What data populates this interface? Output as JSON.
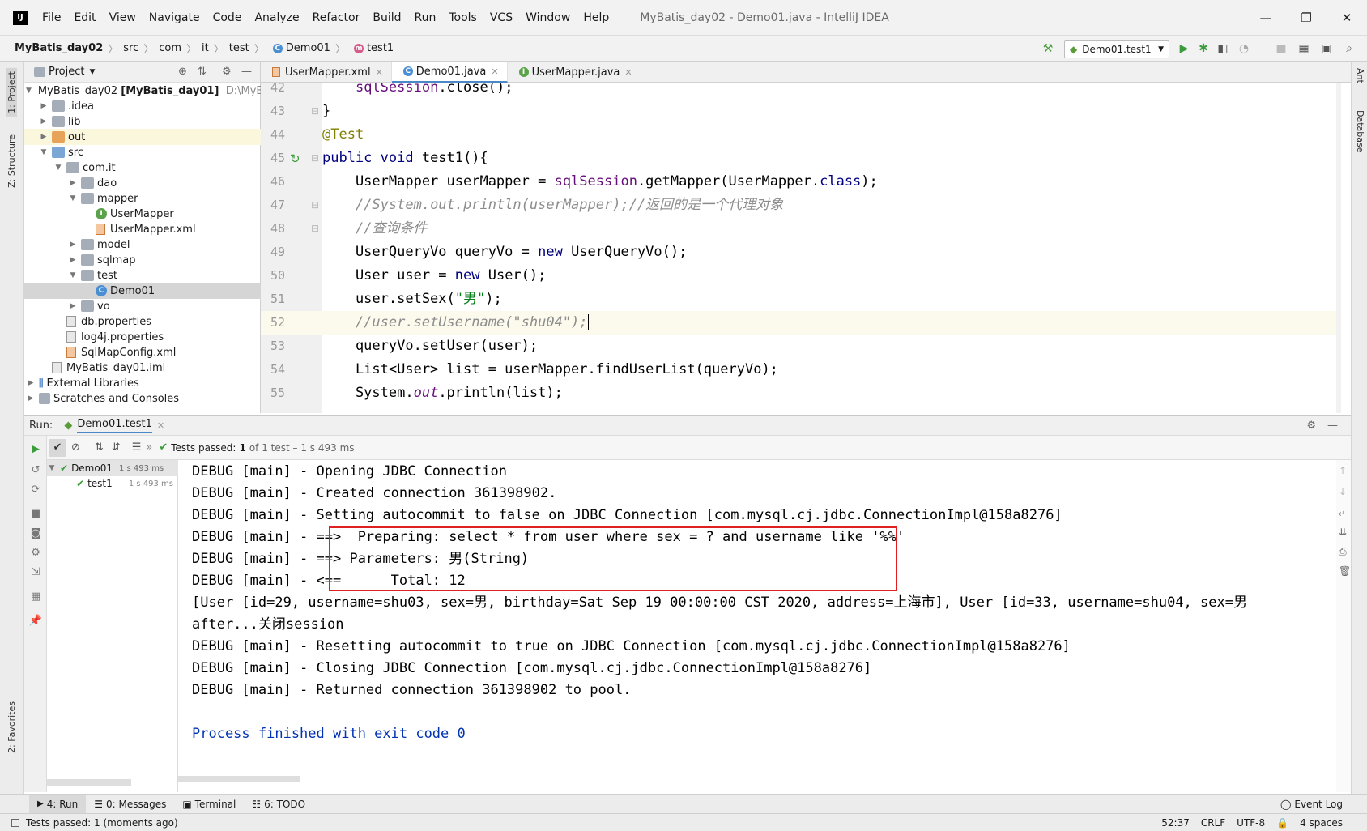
{
  "menubar": {
    "items": [
      "File",
      "Edit",
      "View",
      "Navigate",
      "Code",
      "Analyze",
      "Refactor",
      "Build",
      "Run",
      "Tools",
      "VCS",
      "Window",
      "Help"
    ],
    "window_title": "MyBatis_day02 - Demo01.java - IntelliJ IDEA"
  },
  "navbar": {
    "breadcrumbs": [
      "MyBatis_day02",
      "src",
      "com",
      "it",
      "test",
      "Demo01",
      "test1"
    ],
    "run_config": "Demo01.test1"
  },
  "left_strip": {
    "project_tab": "1: Project",
    "structure_tab": "Z: Structure",
    "favorites_tab": "2: Favorites"
  },
  "right_strip": {
    "ant_tab": "Ant",
    "database_tab": "Database"
  },
  "project": {
    "header": "Project",
    "tree": [
      {
        "label": "MyBatis_day02",
        "bold": "[MyBatis_day01]",
        "path": "D:\\MyBati"
      },
      {
        "label": ".idea"
      },
      {
        "label": "lib"
      },
      {
        "label": "out"
      },
      {
        "label": "src"
      },
      {
        "label": "com.it"
      },
      {
        "label": "dao"
      },
      {
        "label": "mapper"
      },
      {
        "label": "UserMapper"
      },
      {
        "label": "UserMapper.xml"
      },
      {
        "label": "model"
      },
      {
        "label": "sqlmap"
      },
      {
        "label": "test"
      },
      {
        "label": "Demo01"
      },
      {
        "label": "vo"
      },
      {
        "label": "db.properties"
      },
      {
        "label": "log4j.properties"
      },
      {
        "label": "SqlMapConfig.xml"
      },
      {
        "label": "MyBatis_day01.iml"
      },
      {
        "label": "External Libraries"
      },
      {
        "label": "Scratches and Consoles"
      }
    ]
  },
  "editor": {
    "tabs": [
      "UserMapper.xml",
      "Demo01.java",
      "UserMapper.java"
    ],
    "line_numbers": [
      "42",
      "43",
      "44",
      "45",
      "46",
      "47",
      "48",
      "49",
      "50",
      "51",
      "52",
      "53",
      "54",
      "55"
    ]
  },
  "run": {
    "label": "Run:",
    "tab": "Demo01.test1",
    "tests_passed_label": "Tests passed:",
    "tests_passed_count": "1",
    "tests_passed_detail": "of 1 test – 1 s 493 ms",
    "test_tree": [
      {
        "name": "Demo01",
        "time": "1 s 493 ms"
      },
      {
        "name": "test1",
        "time": "1 s 493 ms"
      }
    ]
  },
  "console": {
    "lines": [
      "DEBUG [main] - Opening JDBC Connection",
      "DEBUG [main] - Created connection 361398902.",
      "DEBUG [main] - Setting autocommit to false on JDBC Connection [com.mysql.cj.jdbc.ConnectionImpl@158a8276]",
      "DEBUG [main] - ==>  Preparing: select * from user where sex = ? and username like '%%'",
      "DEBUG [main] - ==> Parameters: 男(String)",
      "DEBUG [main] - <==      Total: 12",
      "[User [id=29, username=shu03, sex=男, birthday=Sat Sep 19 00:00:00 CST 2020, address=上海市], User [id=33, username=shu04, sex=男",
      "after...关闭session",
      "DEBUG [main] - Resetting autocommit to true on JDBC Connection [com.mysql.cj.jdbc.ConnectionImpl@158a8276]",
      "DEBUG [main] - Closing JDBC Connection [com.mysql.cj.jdbc.ConnectionImpl@158a8276]",
      "DEBUG [main] - Returned connection 361398902 to pool.",
      "",
      "Process finished with exit code 0"
    ]
  },
  "bottom_tabs": [
    "4: Run",
    "0: Messages",
    "Terminal",
    "6: TODO"
  ],
  "event_log": "Event Log",
  "status": {
    "message": "Tests passed: 1 (moments ago)",
    "position": "52:37",
    "line_sep": "CRLF",
    "encoding": "UTF-8",
    "indent": "4 spaces"
  }
}
